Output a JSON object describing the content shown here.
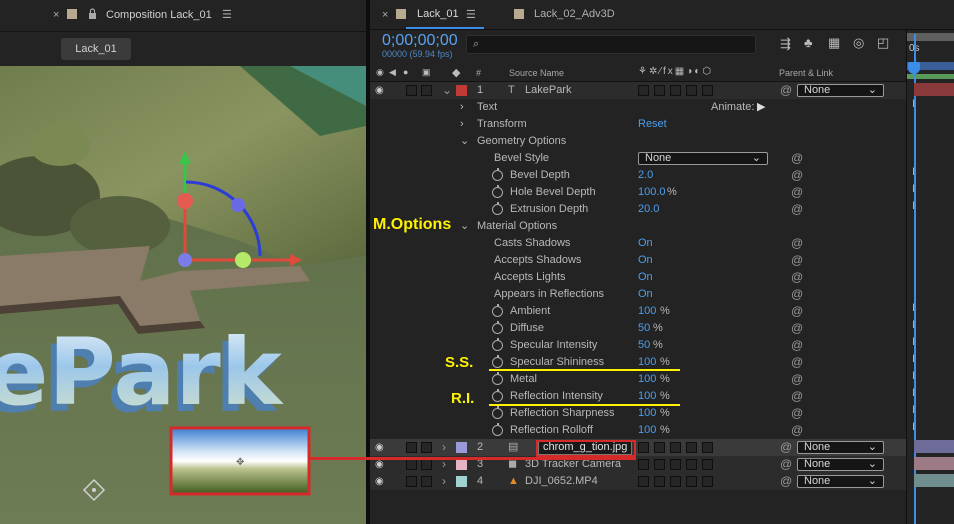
{
  "comp_panel": {
    "close": "×",
    "title": "Composition Lack_01",
    "menu": "☰",
    "tab": "Lack_01",
    "text_3d": "ePark"
  },
  "timeline": {
    "tabs": [
      {
        "label": "Lack_01",
        "color": "#b6ab90",
        "active": true
      },
      {
        "label": "Lack_02_Adv3D",
        "color": "#b6ab90",
        "active": false
      }
    ],
    "timecode": "0;00;00;00",
    "fps": "00000 (59.94 fps)",
    "search_placeholder": "",
    "ruler_label": "0s",
    "headers": {
      "number": "#",
      "source": "Source Name",
      "parent": "Parent & Link"
    },
    "layers": [
      {
        "num": "1",
        "name": "LakePark",
        "color": "#c13a37",
        "parent": "None"
      },
      {
        "num": "2",
        "name": "chrom_g_tion.jpg",
        "color": "#9b9ad8",
        "parent": "None"
      },
      {
        "num": "3",
        "name": "3D Tracker Camera",
        "color": "#e5b4c2",
        "parent": "None"
      },
      {
        "num": "4",
        "name": "DJI_0652.MP4",
        "color": "#9fd2d1",
        "parent": "None"
      }
    ],
    "props": {
      "text": "Text",
      "animate": "Animate:",
      "transform": "Transform",
      "reset": "Reset",
      "geometry": "Geometry Options",
      "bevel_style": "Bevel Style",
      "bevel_style_val": "None",
      "bevel_depth": "Bevel Depth",
      "bevel_depth_val": "2.0",
      "hole_bevel": "Hole Bevel Depth",
      "hole_bevel_val": "100.0",
      "pct": "%",
      "extrusion": "Extrusion Depth",
      "extrusion_val": "20.0",
      "material": "Material Options",
      "casts": "Casts Shadows",
      "casts_val": "On",
      "accepts_shadows": "Accepts Shadows",
      "accepts_shadows_val": "On",
      "accepts_lights": "Accepts Lights",
      "accepts_lights_val": "On",
      "appears": "Appears in Reflections",
      "appears_val": "On",
      "ambient": "Ambient",
      "ambient_val": "100",
      "diffuse": "Diffuse",
      "diffuse_val": "50",
      "spec_int": "Specular Intensity",
      "spec_int_val": "50",
      "spec_shine": "Specular Shininess",
      "spec_shine_val": "100",
      "metal": "Metal",
      "metal_val": "100",
      "refl_int": "Reflection Intensity",
      "refl_int_val": "100",
      "refl_sharp": "Reflection Sharpness",
      "refl_sharp_val": "100",
      "refl_roll": "Reflection Rolloff",
      "refl_roll_val": "100"
    }
  },
  "annotations": {
    "m_options": "M.Options",
    "ss": "S.S.",
    "ri": "R.I."
  },
  "colors": {
    "accent": "#4d9fee",
    "annotation": "#fff200",
    "callout": "#d62a2a"
  }
}
